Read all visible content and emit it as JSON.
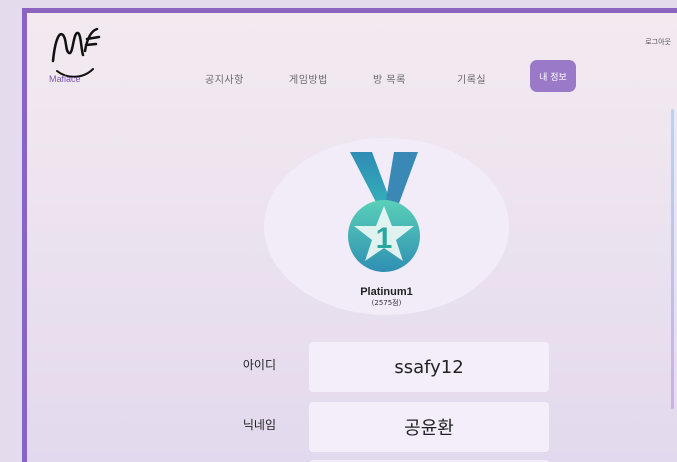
{
  "brand": {
    "name": "Mafiace"
  },
  "nav": {
    "items": [
      "공지사항",
      "게임방법",
      "방 목록",
      "기록실"
    ],
    "active": "내 정보"
  },
  "header": {
    "logout": "로그아웃"
  },
  "profile": {
    "tier": "Platinum1",
    "points": "(2575점)",
    "medal_number": "1",
    "id_label": "아이디",
    "id_value": "ssafy12",
    "nickname_label": "닉네임",
    "nickname_value": "공윤환"
  },
  "colors": {
    "accent": "#8d63c0",
    "active_tab": "#9a79c9",
    "medal_teal": "#2aa7a0",
    "medal_blue": "#3a7fb2"
  }
}
